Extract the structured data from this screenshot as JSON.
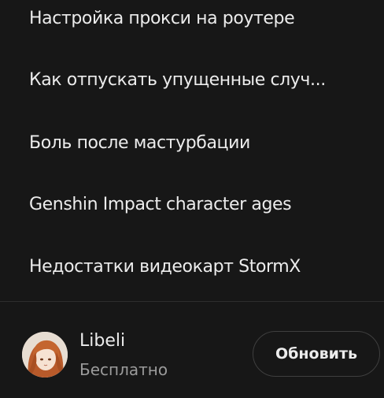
{
  "history": {
    "items": [
      {
        "label": "Настройка прокси на роутере"
      },
      {
        "label": "Как отпускать упущенные случ..."
      },
      {
        "label": "Боль после мастурбации"
      },
      {
        "label": "Genshin Impact character ages"
      },
      {
        "label": "Недостатки видеокарт StormX"
      }
    ]
  },
  "account": {
    "name": "Libeli",
    "plan": "Бесплатно",
    "avatar_icon": "anime-avatar",
    "upgrade_label": "Обновить"
  },
  "colors": {
    "background": "#171717",
    "text": "#ececec",
    "muted_text": "#9b9b9b",
    "button_border": "#3f3f3f"
  }
}
